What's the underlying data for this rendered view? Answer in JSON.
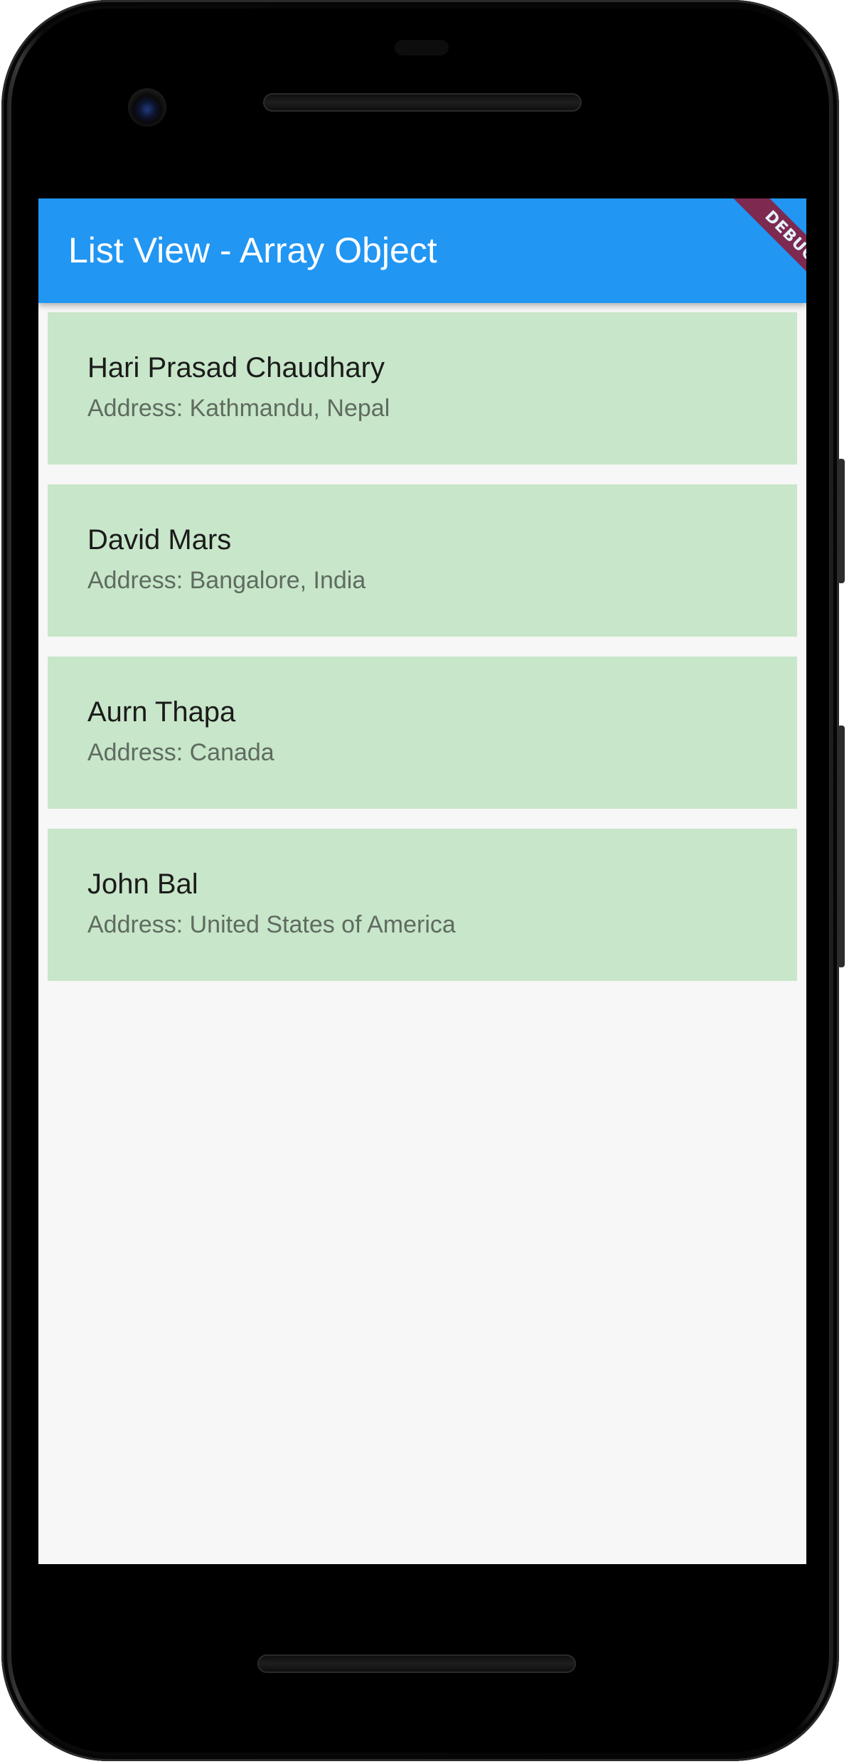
{
  "app_bar": {
    "title": "List View - Array Object",
    "color": "#2196f3"
  },
  "debug_banner": {
    "label": "DEBUG"
  },
  "list": {
    "item_color": "#c8e6c9",
    "items": [
      {
        "name": "Hari Prasad Chaudhary",
        "address": "Address: Kathmandu, Nepal"
      },
      {
        "name": "David Mars",
        "address": "Address: Bangalore, India"
      },
      {
        "name": "Aurn Thapa",
        "address": "Address: Canada"
      },
      {
        "name": "John Bal",
        "address": "Address: United States of America"
      }
    ]
  }
}
